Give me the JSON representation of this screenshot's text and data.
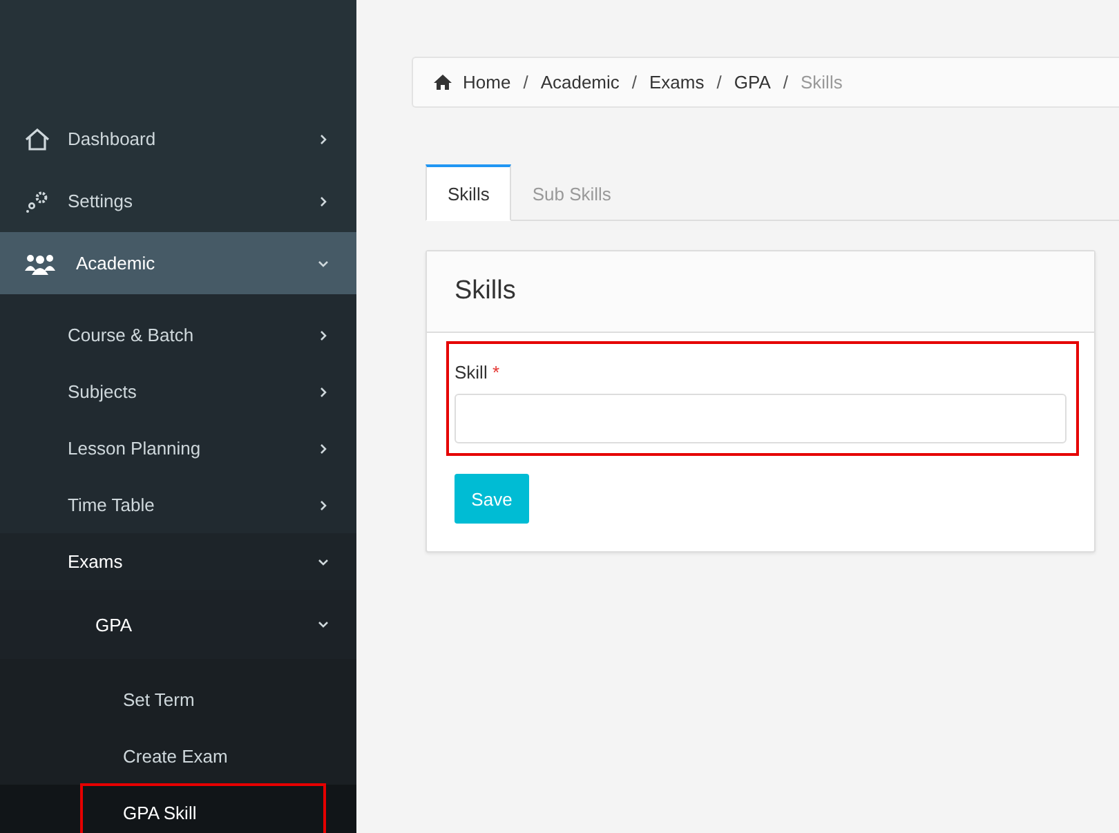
{
  "sidebar": {
    "items": [
      {
        "label": "Dashboard",
        "expanded": false,
        "selected": false
      },
      {
        "label": "Settings",
        "expanded": false,
        "selected": false
      },
      {
        "label": "Academic",
        "expanded": true,
        "selected": true,
        "children": [
          {
            "label": "Course & Batch",
            "expanded": false,
            "selected": false
          },
          {
            "label": "Subjects",
            "expanded": false,
            "selected": false
          },
          {
            "label": "Lesson Planning",
            "expanded": false,
            "selected": false
          },
          {
            "label": "Time Table",
            "expanded": false,
            "selected": false
          },
          {
            "label": "Exams",
            "expanded": true,
            "selected": false,
            "children": [
              {
                "label": "GPA",
                "expanded": true,
                "selected": false,
                "children": [
                  {
                    "label": "Set Term",
                    "selected": false,
                    "highlighted": false
                  },
                  {
                    "label": "Create Exam",
                    "selected": false,
                    "highlighted": false
                  },
                  {
                    "label": "GPA Skill",
                    "selected": true,
                    "highlighted": true
                  }
                ]
              }
            ]
          }
        ]
      }
    ]
  },
  "breadcrumb": {
    "separator": "/",
    "items": [
      "Home",
      "Academic",
      "Exams",
      "GPA",
      "Skills"
    ]
  },
  "tabs": [
    {
      "label": "Skills",
      "selected": true
    },
    {
      "label": "Sub Skills",
      "selected": false
    }
  ],
  "card": {
    "title": "Skills",
    "field": {
      "label": "Skill",
      "required_mark": "*",
      "highlighted": true
    },
    "button": "Save"
  }
}
